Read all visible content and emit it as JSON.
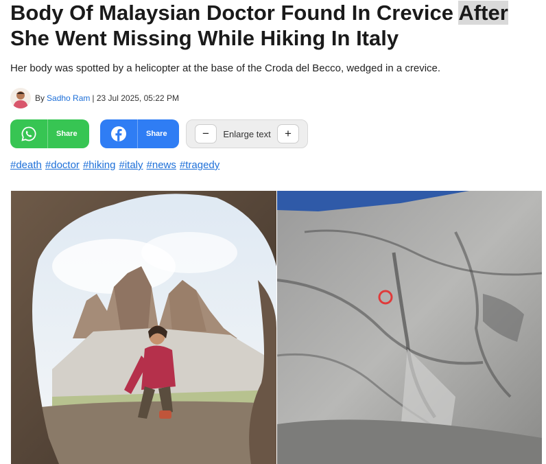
{
  "article": {
    "title_main": "Body Of Malaysian Doctor Found In Crevice ",
    "title_highlight": "After",
    "title_line2": "She Went Missing While Hiking In Italy",
    "subtitle": "Her body was spotted by a helicopter at the base of the Croda del Becco, wedged in a crevice.",
    "byline_prefix": "By",
    "author": "Sadho Ram",
    "separator": "|",
    "date": "23 Jul 2025, 05:22 PM"
  },
  "share": {
    "whatsapp_label": "Share",
    "facebook_label": "Share",
    "enlarge_label": "Enlarge text",
    "minus": "−",
    "plus": "+"
  },
  "tags": [
    "#death",
    "#doctor",
    "#hiking",
    "#italy",
    "#news",
    "#tragedy"
  ],
  "colors": {
    "whatsapp": "#37c553",
    "facebook": "#2f7df4",
    "link": "#1d6fd8",
    "highlight": "#d9d9d9"
  },
  "icons": [
    "whatsapp-icon",
    "facebook-icon"
  ]
}
